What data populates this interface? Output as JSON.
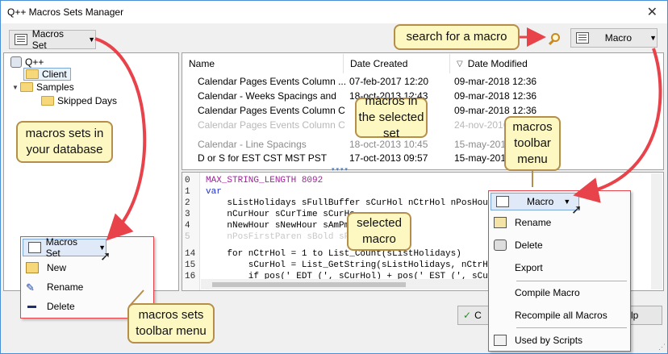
{
  "window": {
    "title": "Q++ Macros Sets Manager",
    "close": "✕"
  },
  "toolbar": {
    "macros_set_label": "Macros Set",
    "macro_label": "Macro"
  },
  "tree": {
    "root": "Q++",
    "items": [
      {
        "label": "Client"
      },
      {
        "label": "Samples"
      },
      {
        "label": "Skipped Days"
      }
    ]
  },
  "grid": {
    "columns": [
      "Name",
      "Date Created",
      "Date Modified"
    ],
    "sort_glyph": "▽",
    "rows": [
      {
        "name": "Calendar Pages Events Column ...",
        "created": "07-feb-2017 12:20",
        "modified": "09-mar-2018 12:36"
      },
      {
        "name": "Calendar - Weeks Spacings and",
        "created": "18-oct-2013 12:43",
        "modified": "09-mar-2018 12:36"
      },
      {
        "name": "Calendar Pages Events Column C",
        "created": "",
        "modified": "09-mar-2018 12:36"
      },
      {
        "name": "Calendar Pages Events Column C",
        "created": "",
        "modified": "24-nov-2016"
      },
      {
        "name": "Calendar - Line Spacings",
        "created": "18-oct-2013 10:45",
        "modified": "15-may-2016"
      },
      {
        "name": "D or S for EST CST MST PST",
        "created": "17-oct-2013 09:57",
        "modified": "15-may-2016"
      }
    ]
  },
  "code": {
    "lines": [
      {
        "n": "0",
        "text": "MAX_STRING_LENGTH 8092"
      },
      {
        "n": "1",
        "text": "var"
      },
      {
        "n": "2",
        "text": "    sListHolidays sFullBuffer sCurHol nCtrHol nPosHour"
      },
      {
        "n": "3",
        "text": "    nCurHour sCurTime sCurHo"
      },
      {
        "n": "4",
        "text": "    nNewHour sNewHour sAmPm s"
      },
      {
        "n": "5",
        "text": "    nPosFirstParen sBold sPla"
      },
      {
        "n": "14",
        "text": "    for nCtrHol = 1 to List_Count(sListHolidays)"
      },
      {
        "n": "15",
        "text": "        sCurHol = List_GetString(sListHolidays, nCtrHol)"
      },
      {
        "n": "16",
        "text": "        if pos(' EDT (', sCurHol) + pos(' EST (', sCurHol)"
      }
    ]
  },
  "macros_set_menu": {
    "header": "Macros Set",
    "items": [
      {
        "label": "New",
        "icon": "new-folder-icon"
      },
      {
        "label": "Rename",
        "icon": "pencil-icon"
      },
      {
        "label": "Delete",
        "icon": "minus-icon"
      }
    ]
  },
  "macro_menu": {
    "header": "Macro",
    "items": [
      {
        "label": "Rename",
        "icon": "rename-icon"
      },
      {
        "label": "Delete",
        "icon": "trash-icon"
      },
      {
        "label": "Export",
        "icon": "export-icon"
      },
      {
        "label": "Compile Macro",
        "icon": ""
      },
      {
        "label": "Recompile all Macros",
        "icon": ""
      },
      {
        "label": "Used by Scripts",
        "icon": "scripts-icon"
      }
    ]
  },
  "bottom": {
    "ok_fragment": "C",
    "help_fragment": "lp"
  },
  "callouts": {
    "search": "search for a macro",
    "sets_db": "macros sets in your database",
    "macros_in_set": "macros in the selected set",
    "macros_toolbar": "macros toolbar menu",
    "selected_macro": "selected macro",
    "sets_toolbar": "macros sets toolbar menu"
  },
  "colors": {
    "callout_bg": "#fdf8c2",
    "callout_border": "#b58e4b",
    "arrow": "#e8434a",
    "keyword": "#1d2fd6",
    "number": "#a11f9b"
  }
}
